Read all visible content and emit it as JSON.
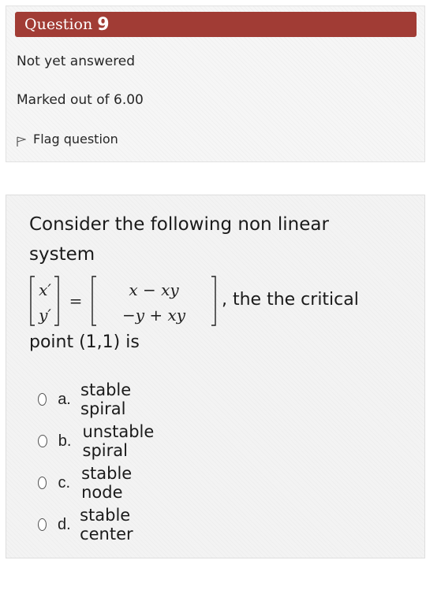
{
  "info": {
    "question_label": "Question",
    "question_number": "9",
    "state": "Not yet answered",
    "grade": "Marked out of 6.00",
    "flag_label": "Flag question",
    "flag_icon": "flag-icon"
  },
  "question": {
    "text": "Consider the following non linear system",
    "after_math": ", the the critical",
    "tail": "point (1,1) is",
    "math": {
      "lhs_top": "x′",
      "lhs_bottom": "y′",
      "equals": "=",
      "rhs_top": "x − xy",
      "rhs_bottom": "−y + xy"
    }
  },
  "answers": [
    {
      "letter": "a.",
      "text": "stable spiral"
    },
    {
      "letter": "b.",
      "text": "unstable spiral"
    },
    {
      "letter": "c.",
      "text": "stable node"
    },
    {
      "letter": "d.",
      "text": "stable center"
    }
  ],
  "colors": {
    "header_bg": "#a13c35",
    "card_bg": "#f6f6f6"
  }
}
